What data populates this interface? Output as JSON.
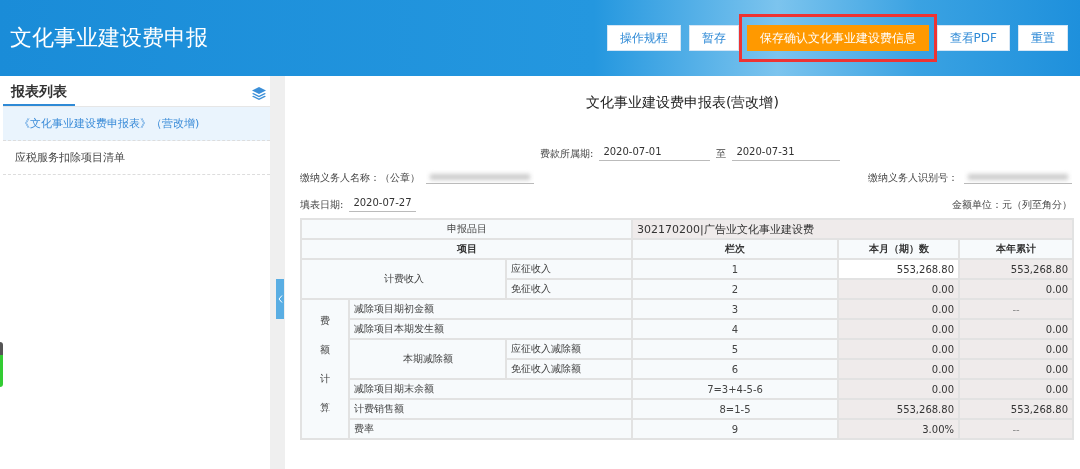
{
  "header": {
    "title": "文化事业建设费申报",
    "buttons": [
      {
        "label": "操作规程",
        "kind": "default",
        "highlighted": false
      },
      {
        "label": "暂存",
        "kind": "default",
        "highlighted": false
      },
      {
        "label": "保存确认文化事业建设费信息",
        "kind": "primary",
        "highlighted": true
      },
      {
        "label": "查看PDF",
        "kind": "default",
        "highlighted": false
      },
      {
        "label": "重置",
        "kind": "default",
        "highlighted": false
      }
    ]
  },
  "sidebar": {
    "title": "报表列表",
    "items": [
      {
        "label": "《文化事业建设费申报表》（营改增)",
        "selected": true
      },
      {
        "label": "应税服务扣除项目清单",
        "selected": false
      }
    ]
  },
  "form": {
    "title": "文化事业建设费申报表(营改增)",
    "period_label": "费款所属期:",
    "period_from": "2020-07-01",
    "period_to_label": "至",
    "period_to": "2020-07-31",
    "taxpayer_name_label": "缴纳义务人名称：（公章）",
    "taxpayer_id_label": "缴纳义务人识别号：",
    "fill_date_label": "填表日期:",
    "fill_date": "2020-07-27",
    "unit_label": "金额单位：元（列至角分）"
  },
  "table": {
    "rows": [
      [
        {
          "text": "申报品目",
          "kind": "center",
          "colspan": 3
        },
        {
          "text": "302170200|广告业文化事业建设费",
          "kind": "info",
          "colspan": 3
        }
      ],
      [
        {
          "text": "项目",
          "kind": "head",
          "colspan": 3
        },
        {
          "text": "栏次",
          "kind": "head"
        },
        {
          "text": "本月（期）数",
          "kind": "head"
        },
        {
          "text": "本年累计",
          "kind": "head"
        }
      ],
      [
        {
          "text": "计费收入",
          "kind": "center",
          "colspan": 2,
          "rowspan": 2
        },
        {
          "text": "应征收入",
          "kind": "label"
        },
        {
          "text": "1",
          "kind": "center"
        },
        {
          "text": "553,268.80",
          "kind": "value",
          "editable": true
        },
        {
          "text": "553,268.80",
          "kind": "value",
          "editable": false
        }
      ],
      [
        {
          "text": "免征收入",
          "kind": "label"
        },
        {
          "text": "2",
          "kind": "center"
        },
        {
          "text": "0.00",
          "kind": "value",
          "editable": false
        },
        {
          "text": "0.00",
          "kind": "value",
          "editable": false
        }
      ],
      [
        {
          "text": "费额计算",
          "kind": "vertical",
          "rowspan": 7
        },
        {
          "text": "减除项目期初金额",
          "kind": "label",
          "colspan": 2
        },
        {
          "text": "3",
          "kind": "center"
        },
        {
          "text": "0.00",
          "kind": "value",
          "editable": false
        },
        {
          "text": "--",
          "kind": "dash"
        }
      ],
      [
        {
          "text": "减除项目本期发生额",
          "kind": "label",
          "colspan": 2
        },
        {
          "text": "4",
          "kind": "center"
        },
        {
          "text": "0.00",
          "kind": "value",
          "editable": false
        },
        {
          "text": "0.00",
          "kind": "value",
          "editable": false
        }
      ],
      [
        {
          "text": "本期减除额",
          "kind": "center",
          "rowspan": 2
        },
        {
          "text": "应征收入减除额",
          "kind": "label"
        },
        {
          "text": "5",
          "kind": "center"
        },
        {
          "text": "0.00",
          "kind": "value",
          "editable": false
        },
        {
          "text": "0.00",
          "kind": "value",
          "editable": false
        }
      ],
      [
        {
          "text": "免征收入减除额",
          "kind": "label"
        },
        {
          "text": "6",
          "kind": "center"
        },
        {
          "text": "0.00",
          "kind": "value",
          "editable": false
        },
        {
          "text": "0.00",
          "kind": "value",
          "editable": false
        }
      ],
      [
        {
          "text": "减除项目期末余额",
          "kind": "label",
          "colspan": 2
        },
        {
          "text": "7=3+4-5-6",
          "kind": "center"
        },
        {
          "text": "0.00",
          "kind": "value",
          "editable": false
        },
        {
          "text": "0.00",
          "kind": "value",
          "editable": false
        }
      ],
      [
        {
          "text": "计费销售额",
          "kind": "label",
          "colspan": 2
        },
        {
          "text": "8=1-5",
          "kind": "center"
        },
        {
          "text": "553,268.80",
          "kind": "value",
          "editable": false
        },
        {
          "text": "553,268.80",
          "kind": "value",
          "editable": false
        }
      ],
      [
        {
          "text": "费率",
          "kind": "label",
          "colspan": 2
        },
        {
          "text": "9",
          "kind": "center"
        },
        {
          "text": "3.00%",
          "kind": "value",
          "editable": false
        },
        {
          "text": "--",
          "kind": "dash"
        }
      ]
    ]
  }
}
